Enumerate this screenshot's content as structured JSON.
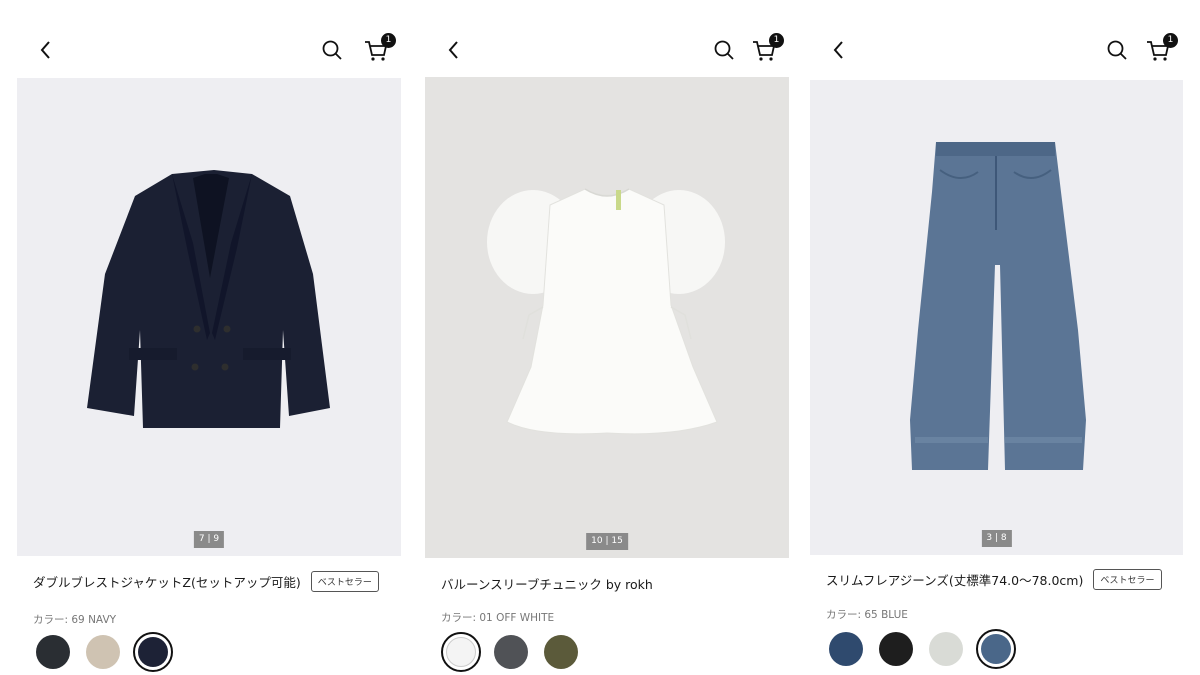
{
  "header": {
    "cart_count": "1"
  },
  "products": [
    {
      "counter": "7 | 9",
      "title": "ダブルブレストジャケットZ(セットアップ可能)",
      "tag": "ベストセラー",
      "color_label": "カラー: 69 NAVY",
      "swatches": [
        {
          "color": "#2a2e33",
          "selected": false
        },
        {
          "color": "#cfc3b2",
          "selected": false
        },
        {
          "color": "#1d2236",
          "selected": true
        }
      ]
    },
    {
      "counter": "10 | 15",
      "title": "バルーンスリーブチュニック by rokh",
      "tag": "",
      "color_label": "カラー: 01 OFF WHITE",
      "swatches": [
        {
          "color": "#f4f4f4",
          "selected": true
        },
        {
          "color": "#505256",
          "selected": false
        },
        {
          "color": "#5b5a3a",
          "selected": false
        }
      ]
    },
    {
      "counter": "3 | 8",
      "title": "スリムフレアジーンズ(丈標準74.0〜78.0cm)",
      "tag": "ベストセラー",
      "color_label": "カラー: 65 BLUE",
      "swatches": [
        {
          "color": "#2f4a6e",
          "selected": false
        },
        {
          "color": "#1e1e1e",
          "selected": false
        },
        {
          "color": "#d9dbd6",
          "selected": false
        },
        {
          "color": "#4a6789",
          "selected": true
        }
      ]
    }
  ]
}
